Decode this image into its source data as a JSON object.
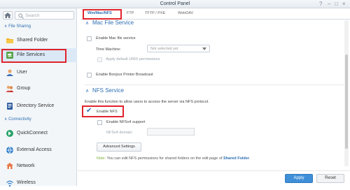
{
  "window": {
    "title": "Control Panel"
  },
  "sidebar": {
    "search_placeholder": "Search",
    "sections": {
      "file_sharing": "File Sharing",
      "connectivity": "Connectivity"
    },
    "items": [
      {
        "label": "Shared Folder"
      },
      {
        "label": "File Services"
      },
      {
        "label": "User"
      },
      {
        "label": "Group"
      },
      {
        "label": "Directory Service"
      },
      {
        "label": "QuickConnect"
      },
      {
        "label": "External Access"
      },
      {
        "label": "Network"
      },
      {
        "label": "Wireless"
      }
    ],
    "active_item": "File Services"
  },
  "tabs": [
    {
      "label": "Win/Mac/NFS"
    },
    {
      "label": "FTP"
    },
    {
      "label": "TFTP / PXE"
    },
    {
      "label": "WebDAV"
    }
  ],
  "mac": {
    "header": "Mac File Service",
    "enable_label": "Enable Mac file service",
    "time_machine_label": "Time Machine:",
    "time_machine_value": "Not selected yet",
    "unix_perm_label": "Apply default UNIX permissions",
    "bonjour_label": "Enable Bonjour Printer Broadcast"
  },
  "nfs": {
    "header": "NFS Service",
    "description": "Enable this function to allow users to access the server via NFS protocol.",
    "enable_label": "Enable NFS",
    "nfsv4_label": "Enable NFSv4 support",
    "domain_label": "NFSv4 domain:",
    "domain_value": "",
    "advanced_label": "Advanced Settings",
    "note_label": "Note:",
    "note_text": " You can edit NFS permissions for shared folders on the edit page of ",
    "note_link": "Shared Folder",
    "note_end": "."
  },
  "footer": {
    "apply_label": "Apply",
    "reset_label": "Reset"
  },
  "colors": {
    "accent": "#2d6fb3",
    "highlight_box": "#e0242c",
    "apply_bg": "#3f8ed8"
  }
}
